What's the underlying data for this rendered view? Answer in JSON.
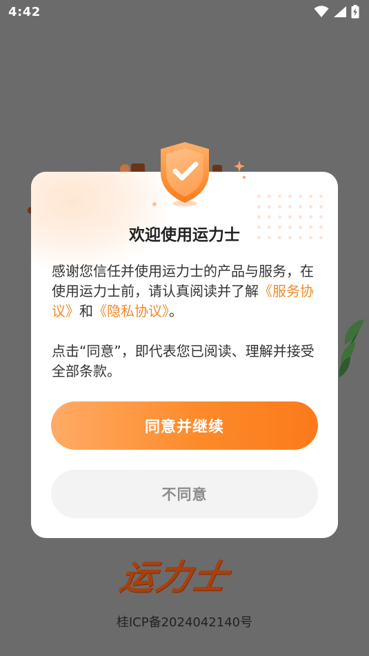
{
  "status_bar": {
    "time": "4:42",
    "icons": [
      "wifi-icon",
      "cellular-signal-icon",
      "battery-charging-icon"
    ]
  },
  "dialog": {
    "title": "欢迎使用运力士",
    "body": {
      "intro": "感谢您信任并使用运力士的产品与服务，在使用运力士前，请认真阅读并了解",
      "service_link": "《服务协议》",
      "conjunction": "和",
      "privacy_link": "《隐私协议》",
      "end": "。",
      "notice": "点击“同意”，即代表您已阅读、理解并接受全部条款。"
    },
    "agree_button": "同意并继续",
    "disagree_button": "不同意",
    "icon": "shield-check-icon"
  },
  "footer": {
    "logo_text": "运力士",
    "icp": "桂ICP备2024042140号"
  },
  "colors": {
    "accent": "#fd8a2a",
    "link": "#f08a2d",
    "overlay": "#6b6b6b",
    "logo": "#a8400e"
  }
}
